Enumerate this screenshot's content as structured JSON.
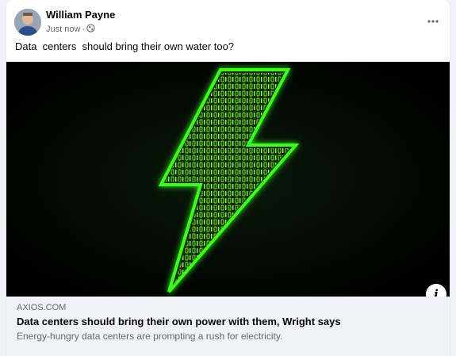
{
  "post": {
    "author": "William Payne",
    "timestamp": "Just now",
    "separator": "·",
    "audience_icon": "globe-icon",
    "more_icon": "more-options-icon",
    "text": "Data  centers  should bring their own water too?"
  },
  "link_preview": {
    "domain": "AXIOS.COM",
    "title": "Data centers should bring their own power with them, Wright says",
    "description": "Energy-hungry data centers are prompting a rush for electricity.",
    "info_icon": "info-icon",
    "image_description": "lightning-bolt-binary-image"
  },
  "colors": {
    "bolt_glow": "#39ff14",
    "bolt_text": "#7CFC00",
    "image_bg": "#000000",
    "preview_bg": "#f0f2f5"
  }
}
